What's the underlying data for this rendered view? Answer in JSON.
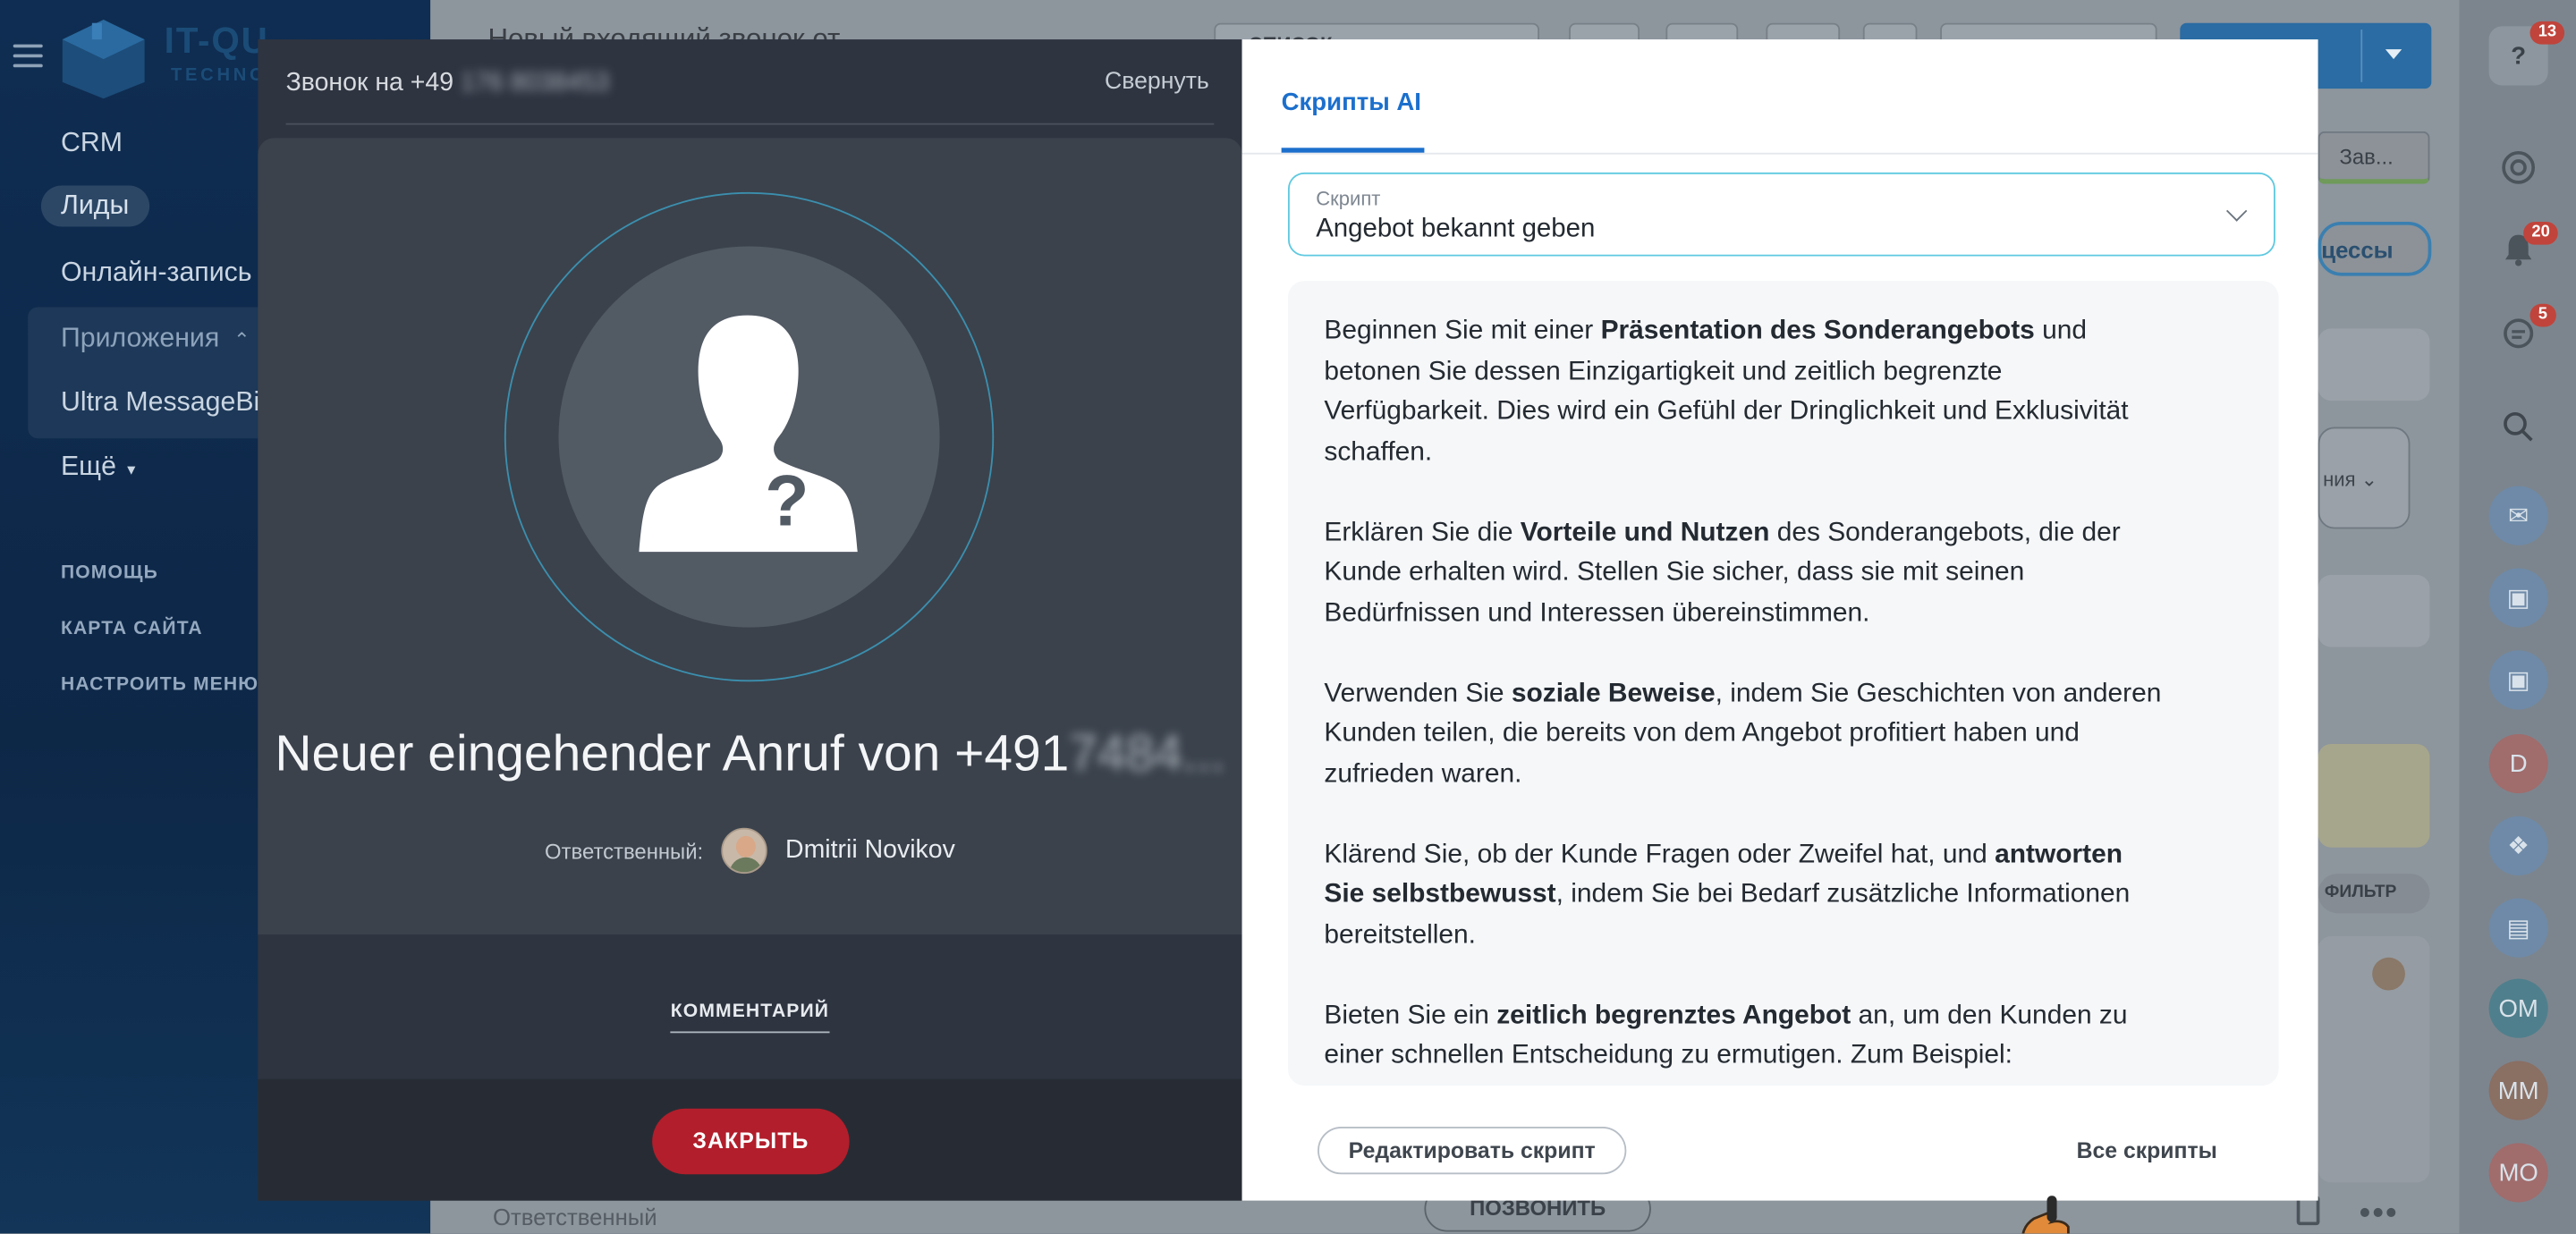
{
  "sidebar": {
    "logo_text": "IT-QU",
    "logo_sub": "TECHNO",
    "items": [
      "CRM",
      "Лиды",
      "Онлайн-запись",
      "Приложения",
      "Ultra MessageBi",
      "Ещё"
    ],
    "small_links": [
      "ПОМОЩЬ",
      "КАРТА САЙТА",
      "НАСТРОИТЬ МЕНЮ"
    ]
  },
  "background_page": {
    "title": "Новый входящий звонок от",
    "list_button": "СПИСОК",
    "chip_zav": "Зав...",
    "chip_processes": "цессы",
    "dropdown_text": "ния",
    "filter_label": "ФИЛЬТР",
    "responsible_label": "Ответственный",
    "call_button": "ПОЗВОНИТЬ"
  },
  "rail": {
    "help_badge": "13",
    "bell_badge": "20",
    "chat_badge": "5",
    "avatars": [
      "D",
      "OM",
      "MM",
      "MO"
    ]
  },
  "call_panel": {
    "header_prefix": "Звонок на +49 ",
    "header_number_hidden": "176 8038453",
    "collapse_label": "Свернуть",
    "caller_title_prefix": "Neuer eingehender Anruf von +491",
    "caller_number_hidden": "7484...",
    "responsible_label": "Ответственный:",
    "responsible_name": "Dmitrii Novikov",
    "comment_tab": "КОММЕНТАРИЙ",
    "close_button": "ЗАКРЫТЬ"
  },
  "script_panel": {
    "tab_label": "Скрипты AI",
    "select_label": "Скрипт",
    "select_value": "Angebot bekannt geben",
    "paragraphs": [
      {
        "a": "Beginnen Sie mit einer ",
        "b": "Präsentation des Sonderangebots",
        "c": " und betonen Sie dessen Einzigartigkeit und zeitlich begrenzte Verfügbarkeit. Dies wird ein Gefühl der Dringlichkeit und Exklusivität schaffen."
      },
      {
        "a": "Erklären Sie die ",
        "b": "Vorteile und Nutzen",
        "c": " des Sonderangebots, die der Kunde erhalten wird. Stellen Sie sicher, dass sie mit seinen Bedürfnissen und Interessen übereinstimmen."
      },
      {
        "a": "Verwenden Sie ",
        "b": "soziale Beweise",
        "c": ", indem Sie Geschichten von anderen Kunden teilen, die bereits von dem Angebot profitiert haben und zufrieden waren."
      },
      {
        "a": "Klärend Sie, ob der Kunde Fragen oder Zweifel hat, und ",
        "b": "antworten Sie selbstbewusst",
        "c": ", indem Sie bei Bedarf zusätzliche Informationen bereitstellen."
      },
      {
        "a": "Bieten Sie ein ",
        "b": "zeitlich begrenztes Angebot",
        "c": " an, um den Kunden zu einer schnellen Entscheidung zu ermutigen. Zum Beispiel:"
      }
    ],
    "edit_button": "Редактировать скрипт",
    "all_scripts_link": "Все скрипты"
  },
  "colors": {
    "accent_blue": "#1c6fcc",
    "close_red": "#b21e2b",
    "select_border": "#5ec9e0",
    "dark_panel": "#2e3440"
  }
}
